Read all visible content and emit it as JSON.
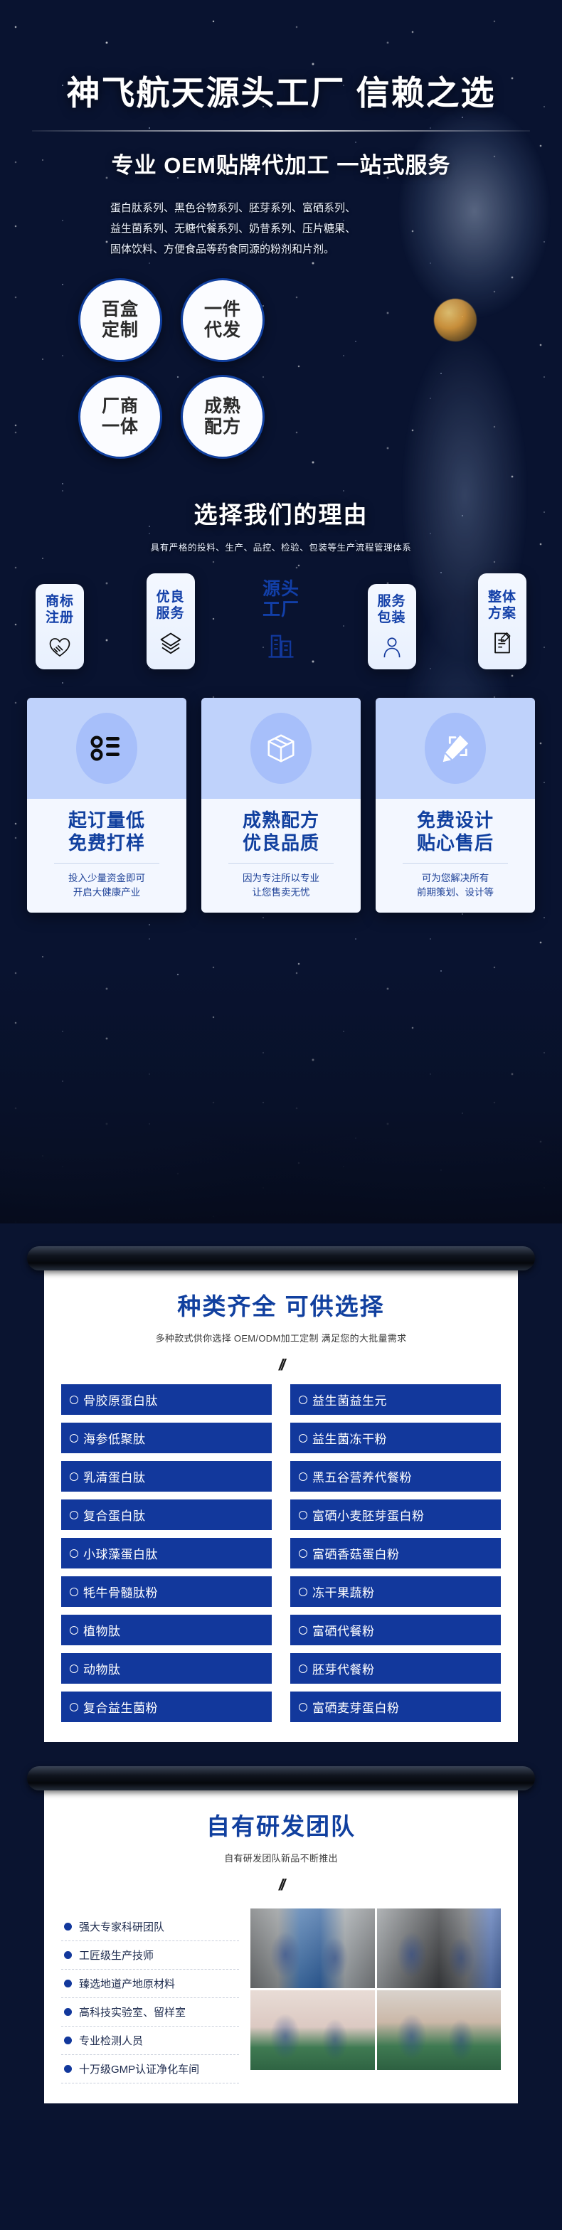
{
  "hero": {
    "main_title": "神飞航天源头工厂 信赖之选",
    "sub_title": "专业 OEM贴牌代加工 一站式服务",
    "desc_lines": [
      "蛋白肽系列、黑色谷物系列、胚芽系列、富硒系列、",
      "益生菌系列、无糖代餐系列、奶昔系列、压片糖果、",
      "固体饮料、方便食品等药食同源的粉剂和片剂。"
    ],
    "circles": [
      {
        "line1": "百盒",
        "line2": "定制"
      },
      {
        "line1": "一件",
        "line2": "代发"
      },
      {
        "line1": "厂商",
        "line2": "一体"
      },
      {
        "line1": "成熟",
        "line2": "配方"
      }
    ],
    "reason_title": "选择我们的理由",
    "reason_sub": "具有严格的投料、生产、品控、检验、包装等生产流程管理体系",
    "chips": [
      {
        "line1": "商标",
        "line2": "注册",
        "icon": "handshake-heart-icon"
      },
      {
        "line1": "优良",
        "line2": "服务",
        "icon": "layers-icon"
      },
      {
        "line1": "源头",
        "line2": "工厂",
        "icon": "factory-building-icon"
      },
      {
        "line1": "服务",
        "line2": "包装",
        "icon": "person-icon"
      },
      {
        "line1": "整体",
        "line2": "方案",
        "icon": "document-edit-icon"
      }
    ],
    "cards3": [
      {
        "icon": "list-bullets-icon",
        "title_line1": "起订量低",
        "title_line2": "免费打样",
        "note_line1": "投入少量资金即可",
        "note_line2": "开启大健康产业"
      },
      {
        "icon": "box-package-icon",
        "title_line1": "成熟配方",
        "title_line2": "优良品质",
        "note_line1": "因为专注所以专业",
        "note_line2": "让您售卖无忧"
      },
      {
        "icon": "pencil-design-icon",
        "title_line1": "免费设计",
        "title_line2": "贴心售后",
        "note_line1": "可为您解决所有",
        "note_line2": "前期策划、设计等"
      }
    ]
  },
  "products_panel": {
    "title": "种类齐全 可供选择",
    "subtitle": "多种款式供你选择 OEM/ODM加工定制 满足您的大批量需求",
    "slash": "//",
    "left_column": [
      "骨胶原蛋白肽",
      "海参低聚肽",
      "乳清蛋白肽",
      "复合蛋白肽",
      "小球藻蛋白肽",
      "牦牛骨髓肽粉",
      "植物肽",
      "动物肽",
      "复合益生菌粉"
    ],
    "right_column": [
      "益生菌益生元",
      "益生菌冻干粉",
      "黑五谷营养代餐粉",
      "富硒小麦胚芽蛋白粉",
      "富硒香菇蛋白粉",
      "冻干果蔬粉",
      "富硒代餐粉",
      "胚芽代餐粉",
      "富硒麦芽蛋白粉"
    ]
  },
  "rd_panel": {
    "title": "自有研发团队",
    "subtitle": "自有研发团队新品不断推出",
    "slash": "//",
    "items": [
      "强大专家科研团队",
      "工匠级生产技师",
      "臻选地道产地原材料",
      "高科技实验室、留样室",
      "专业检测人员",
      "十万级GMP认证净化车间"
    ],
    "photos": [
      "factory-tanks-photo",
      "factory-equipment-photo",
      "cleanroom-corridor-photo",
      "packing-line-photo"
    ]
  },
  "colors": {
    "brand_blue": "#12389c",
    "deep_navy": "#0a1430",
    "chip_blue": "#123fa8",
    "card_light": "#bfd2fb"
  }
}
